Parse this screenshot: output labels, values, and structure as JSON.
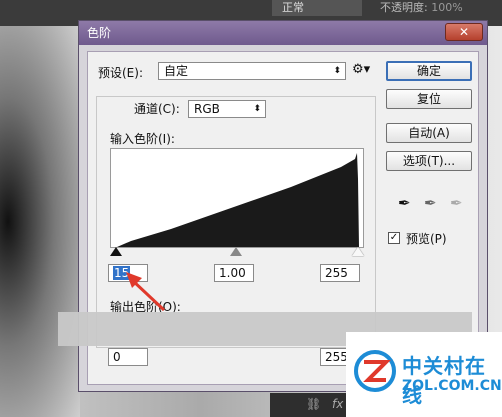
{
  "background": {
    "blend_mode": "正常",
    "opacity_label": "不透明度:",
    "opacity_value": "100%"
  },
  "dialog": {
    "title": "色阶",
    "preset_label": "预设(E):",
    "preset_value": "自定",
    "channel_label": "通道(C):",
    "channel_value": "RGB",
    "input_levels_label": "输入色阶(I):",
    "input_black": "15",
    "input_gamma": "1.00",
    "input_white": "255",
    "output_levels_label": "输出色阶(O):",
    "output_black": "0",
    "output_white": "255",
    "buttons": {
      "ok": "确定",
      "reset": "复位",
      "auto": "自动(A)",
      "options": "选项(T)..."
    },
    "preview_label": "预览(P)",
    "preview_checked": true,
    "close_glyph": "✕"
  },
  "watermark": {
    "cn": "中关村在线",
    "en": "ZOL.COM.CN"
  },
  "colors": {
    "title_bar": "#7a659a",
    "accent": "#3173c9",
    "annotation_arrow": "#e0392b"
  }
}
